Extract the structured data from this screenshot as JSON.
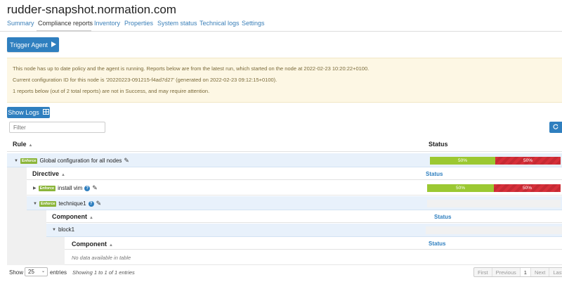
{
  "header": {
    "title": "rudder-snapshot.normation.com"
  },
  "tabs": [
    {
      "label": "Summary"
    },
    {
      "label": "Compliance reports"
    },
    {
      "label": "Inventory"
    },
    {
      "label": "Properties"
    },
    {
      "label": "System status"
    },
    {
      "label": "Technical logs"
    },
    {
      "label": "Settings"
    }
  ],
  "actions": {
    "trigger_label": "Trigger Agent",
    "logs_label": "Show Logs"
  },
  "alert": {
    "line1": "This node has up to date policy and the agent is running. Reports below are from the latest run, which started on the node at 2022-02-23 10:20:22+0100.",
    "line2": "Current configuration ID for this node is '20220223-091215-f4ad7d27' (generated on 2022-02-23 09:12:15+0100).",
    "line3": "1 reports below (out of 2 total reports) are not in Success, and may require attention."
  },
  "filter": {
    "placeholder": "Filter"
  },
  "table": {
    "rule_header": "Rule",
    "status_header": "Status",
    "rule": {
      "badge": "Enforce",
      "name": "Global configuration for all nodes",
      "success": "50%",
      "error": "50%"
    },
    "directive_header": "Directive",
    "directives": [
      {
        "badge": "Enforce",
        "name": "install vim",
        "success": "50%",
        "error": "50%"
      },
      {
        "badge": "Enforce",
        "name": "technique1"
      }
    ],
    "component_header": "Component",
    "block": {
      "name": "block1"
    },
    "subcomponent_header": "Component",
    "empty_text": "No data available in table"
  },
  "footer": {
    "show_label": "Show",
    "page_size": "25",
    "entries_label": "entries",
    "info": "Showing 1 to 1 of 1 entries",
    "pager": {
      "first": "First",
      "previous": "Previous",
      "current": "1",
      "next": "Next",
      "last": "Last"
    }
  },
  "colors": {
    "accent": "#2f7fbf",
    "success": "#9bc832",
    "error": "#d7303a",
    "enforce": "#8bb53a",
    "alert_bg": "#fdf7e4"
  }
}
